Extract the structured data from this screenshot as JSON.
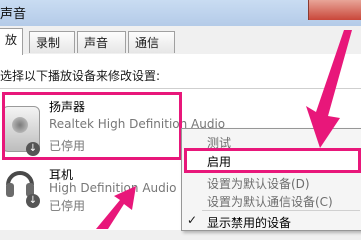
{
  "window": {
    "title": "声音"
  },
  "tabs": [
    {
      "label": "放",
      "active": true
    },
    {
      "label": "录制",
      "active": false
    },
    {
      "label": "声音",
      "active": false
    },
    {
      "label": "通信",
      "active": false
    }
  ],
  "instruction": "选择以下播放设备来修改设置:",
  "devices": [
    {
      "name": "扬声器",
      "description": "Realtek High Definition Audio",
      "status": "已停用",
      "icon": "speaker-icon"
    },
    {
      "name": "耳机",
      "description": "High Definition Audio",
      "status": "已停用",
      "icon": "headphones-icon"
    }
  ],
  "context_menu": {
    "items": [
      {
        "label": "测试",
        "enabled": false
      },
      {
        "label": "启用",
        "enabled": true
      },
      {
        "label": "设置为默认设备(D)",
        "enabled": false
      },
      {
        "label": "设置为默认通信设备(C)",
        "enabled": false
      }
    ],
    "checked_item": {
      "label": "显示禁用的设备",
      "checked": true
    }
  },
  "annotation_colors": {
    "highlight": "#e8177a"
  }
}
